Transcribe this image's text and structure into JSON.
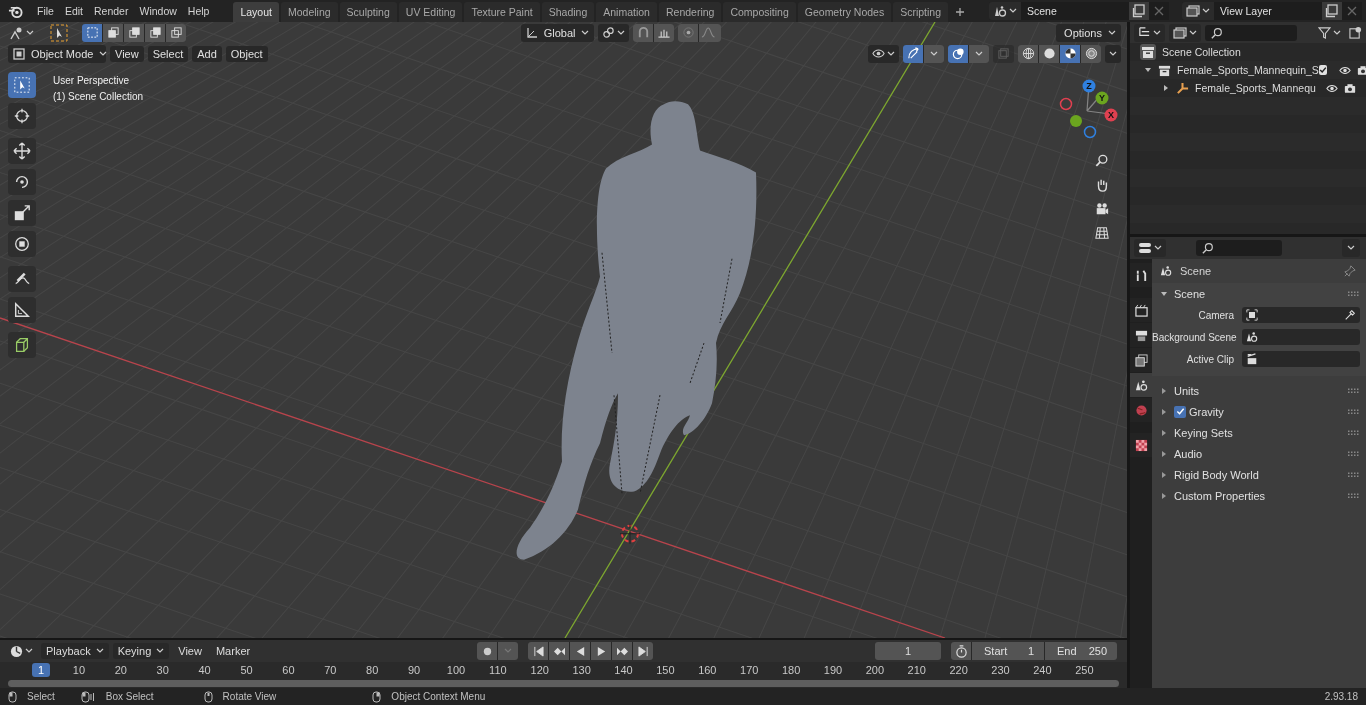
{
  "menu": [
    "File",
    "Edit",
    "Render",
    "Window",
    "Help"
  ],
  "workspace_tabs": [
    {
      "label": "Layout",
      "selected": true
    },
    {
      "label": "Modeling",
      "selected": false
    },
    {
      "label": "Sculpting",
      "selected": false
    },
    {
      "label": "UV Editing",
      "selected": false
    },
    {
      "label": "Texture Paint",
      "selected": false
    },
    {
      "label": "Shading",
      "selected": false
    },
    {
      "label": "Animation",
      "selected": false
    },
    {
      "label": "Rendering",
      "selected": false
    },
    {
      "label": "Compositing",
      "selected": false
    },
    {
      "label": "Geometry Nodes",
      "selected": false
    },
    {
      "label": "Scripting",
      "selected": false
    }
  ],
  "scene_field": {
    "value": "Scene"
  },
  "view_layer_field": {
    "value": "View Layer"
  },
  "viewport": {
    "select_modes": [
      {
        "selected": true
      },
      {
        "selected": false
      },
      {
        "selected": false
      },
      {
        "selected": false
      },
      {
        "selected": false
      }
    ],
    "orientation": "Global",
    "options_button": "Options",
    "mode": "Object Mode",
    "menus": [
      "View",
      "Select",
      "Add",
      "Object"
    ],
    "gizmos_on": true,
    "overlays_on": true,
    "shading_modes": [
      {
        "kind": "wireframe",
        "selected": false
      },
      {
        "kind": "solid",
        "selected": false
      },
      {
        "kind": "material",
        "selected": true
      },
      {
        "kind": "rendered",
        "selected": false
      }
    ],
    "overlay_text": [
      "User Perspective",
      "(1) Scene Collection"
    ],
    "tools": [
      {
        "kind": "select",
        "selected": true
      },
      {
        "kind": "cursor",
        "selected": false
      },
      {
        "kind": "move",
        "selected": false
      },
      {
        "kind": "rotate",
        "selected": false
      },
      {
        "kind": "scale",
        "selected": false
      },
      {
        "kind": "transform",
        "selected": false
      },
      {
        "kind": "annotate",
        "selected": false
      },
      {
        "kind": "measure",
        "selected": false
      },
      {
        "kind": "add-cube",
        "selected": false
      }
    ],
    "gizmo_axes": [
      {
        "label": "Z",
        "color": "#2f80e0"
      },
      {
        "label": "Y",
        "color": "#6ba51f"
      },
      {
        "label": "X",
        "color": "#e04050"
      }
    ]
  },
  "outliner": {
    "items": [
      {
        "label": "Scene Collection",
        "kind": "scene-collection",
        "children": [
          {
            "label": "Female_Sports_Mannequin_S",
            "kind": "collection",
            "expanded": true,
            "checked": true,
            "children": [
              {
                "label": "Female_Sports_Mannequ",
                "kind": "armature",
                "expanded": false
              }
            ]
          }
        ]
      }
    ]
  },
  "properties": {
    "tabs": [
      {
        "kind": "tool",
        "selected": false
      },
      {
        "kind": "render",
        "selected": false
      },
      {
        "kind": "output",
        "selected": false
      },
      {
        "kind": "view-layer",
        "selected": false
      },
      {
        "kind": "scene",
        "selected": true
      },
      {
        "kind": "world",
        "selected": false
      },
      {
        "kind": "texture",
        "selected": false
      }
    ],
    "context_title": "Scene",
    "panel": {
      "title": "Scene",
      "expanded": true,
      "fields": [
        {
          "label": "Camera",
          "kind": "camera"
        },
        {
          "label": "Background Scene",
          "kind": "scene"
        },
        {
          "label": "Active Clip",
          "kind": "clip"
        }
      ]
    },
    "sections": [
      {
        "label": "Units",
        "kind": "plain",
        "expanded": false
      },
      {
        "label": "Gravity",
        "kind": "checkbox",
        "checked": true,
        "expanded": false
      },
      {
        "label": "Keying Sets",
        "kind": "plain",
        "expanded": false
      },
      {
        "label": "Audio",
        "kind": "plain",
        "expanded": false
      },
      {
        "label": "Rigid Body World",
        "kind": "plain",
        "expanded": false
      },
      {
        "label": "Custom Properties",
        "kind": "plain",
        "expanded": false
      }
    ]
  },
  "timeline": {
    "menus": [
      {
        "label": "Playback",
        "dropdown": true
      },
      {
        "label": "Keying",
        "dropdown": true
      },
      {
        "label": "View",
        "dropdown": false
      },
      {
        "label": "Marker",
        "dropdown": false
      }
    ],
    "current_frame": "1",
    "start": {
      "label": "Start",
      "value": "1"
    },
    "end": {
      "label": "End",
      "value": "250"
    },
    "frame_marker": "1",
    "ruler_labels": [
      "10",
      "20",
      "30",
      "40",
      "50",
      "60",
      "70",
      "80",
      "90",
      "100",
      "110",
      "120",
      "130",
      "140",
      "150",
      "160",
      "170",
      "180",
      "190",
      "200",
      "210",
      "220",
      "230",
      "240",
      "250"
    ]
  },
  "status_bar": {
    "hints": [
      {
        "label": "Select",
        "kind": "left"
      },
      {
        "label": "Box Select",
        "kind": "drag"
      },
      {
        "label": "Rotate View",
        "kind": "middle"
      },
      {
        "label": "Object Context Menu",
        "kind": "right"
      }
    ],
    "version": "2.93.18"
  }
}
